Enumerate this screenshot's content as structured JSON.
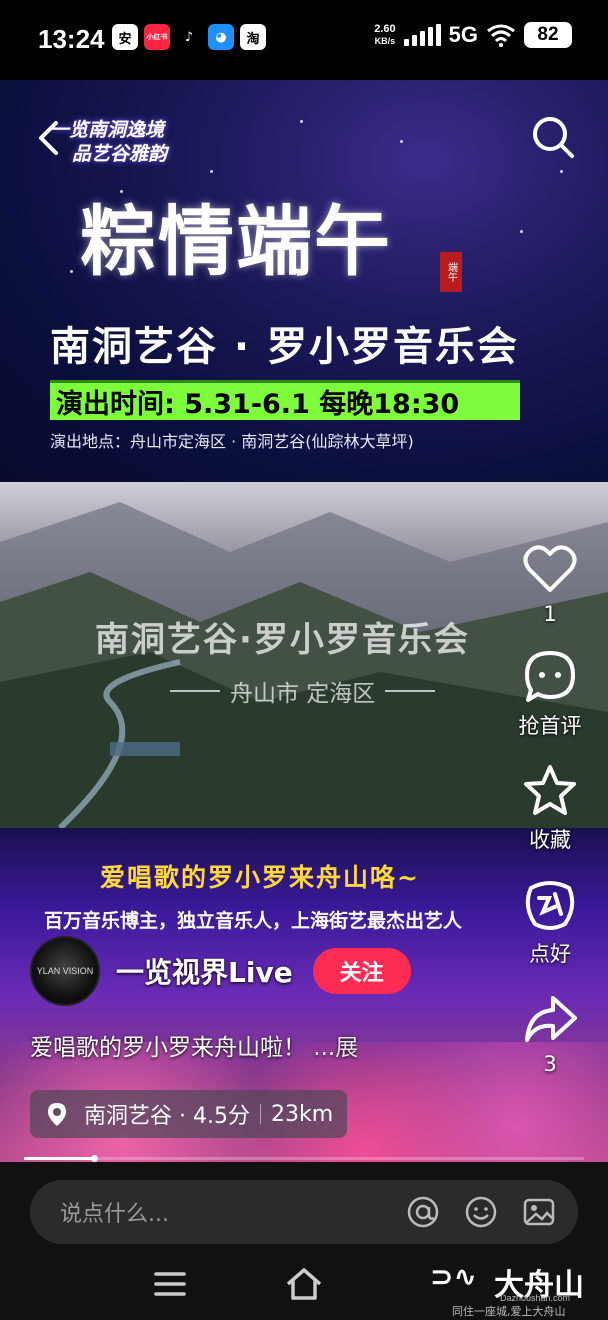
{
  "status_bar": {
    "time": "13:24",
    "app_icons": [
      {
        "name": "anjian-icon",
        "label": "安",
        "bg": "#ffffff",
        "fg": "#000000"
      },
      {
        "name": "xiaohongshu-icon",
        "label": "小红书",
        "bg": "#ff2442",
        "fg": "#ffffff"
      },
      {
        "name": "douyin-icon",
        "label": "♪",
        "bg": "#000000",
        "fg": "#ffffff"
      },
      {
        "name": "bot-icon",
        "label": "◕",
        "bg": "#1e90ff",
        "fg": "#ffffff"
      },
      {
        "name": "taobao-icon",
        "label": "淘",
        "bg": "#ffffff",
        "fg": "#000000"
      }
    ],
    "net_speed_value": "2.60",
    "net_speed_unit": "KB/s",
    "network": "5G",
    "battery": "82"
  },
  "poster": {
    "tagline_line1": "一览南洞逸境",
    "tagline_line2": "品艺谷雅韵",
    "calligraphy": "粽情端午",
    "seal": "端午",
    "title": "南洞艺谷 · 罗小罗音乐会",
    "band_text": "演出时间:  5.31-6.1  每晚18:30",
    "venue": "演出地点：舟山市定海区 · 南洞艺谷(仙踪林大草坪)",
    "scenic_title": "南洞艺谷·罗小罗音乐会",
    "scenic_sub": "舟山市 定海区",
    "bottom_line1": "爱唱歌的罗小罗来舟山咯~",
    "bottom_line2": "百万音乐博主，独立音乐人，上海街艺最杰出艺人"
  },
  "actions": {
    "like_count": "1",
    "comment_label": "抢首评",
    "favorite_label": "收藏",
    "recommend_label": "点好",
    "share_count": "3"
  },
  "author": {
    "avatar_text": "YLAN VISION",
    "name": "一览视界Live",
    "follow_label": "关注"
  },
  "caption": {
    "text": "爱唱歌的罗小罗来舟山啦！ ...",
    "more": "展"
  },
  "poi": {
    "name": "南洞艺谷 · 4.5分",
    "distance": "23km"
  },
  "progress": {
    "fraction": 0.125
  },
  "comment_bar": {
    "placeholder": "说点什么..."
  },
  "watermark": {
    "logo_cn": "大舟山",
    "url": "Dazhoushan.com",
    "slogan": "同住一座城,爱上大舟山"
  },
  "colors": {
    "follow_button": "#fe2c55",
    "band_green": "#7CFC3A",
    "highlight_yellow": "#ffd83b"
  }
}
